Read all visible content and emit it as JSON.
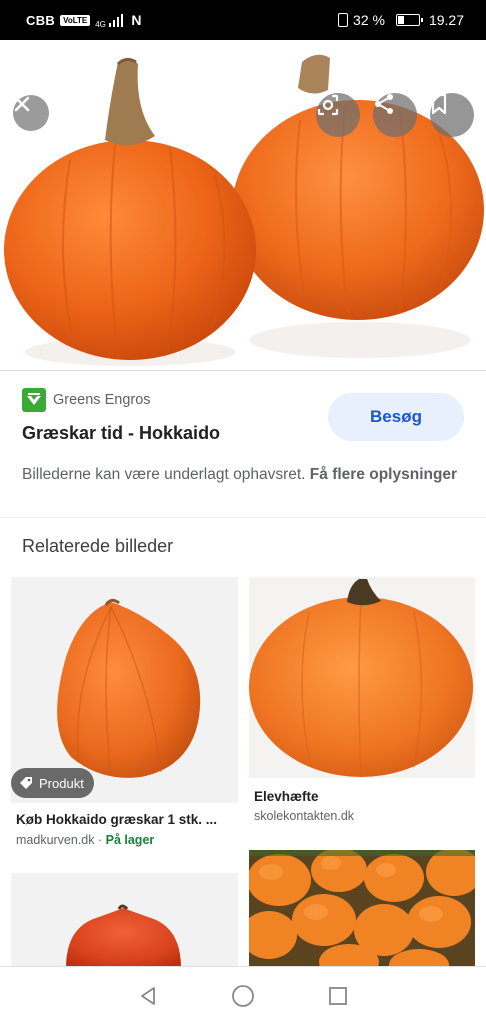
{
  "status_bar": {
    "carrier": "CBB",
    "volte": "VoLTE",
    "network": "4G",
    "nfc": "N",
    "battery_percent": "32 %",
    "battery_level": 0.32,
    "time": "19.27"
  },
  "hero": {
    "close_icon": "close-icon",
    "lens_icon": "lens-icon",
    "share_icon": "share-icon",
    "save_icon": "bookmark-icon"
  },
  "result": {
    "source_name": "Greens Engros",
    "title": "Græskar tid - Hokkaido",
    "visit_label": "Besøg",
    "copyright_text": "Billederne kan være underlagt ophavsret.",
    "more_info_link": "Få flere oplysninger"
  },
  "related": {
    "heading": "Relaterede billeder",
    "items": [
      {
        "tag": "Produkt",
        "title": "Køb Hokkaido græskar 1 stk. ...",
        "source": "madkurven.dk",
        "separator": " · ",
        "status": "På lager"
      },
      {
        "title": "Elevhæfte",
        "source": "skolekontakten.dk"
      },
      {},
      {}
    ]
  },
  "colors": {
    "accent": "#1a57c9",
    "visit_bg": "#e8f0fe",
    "in_stock": "#188038",
    "pumpkin": "#e8601c"
  }
}
